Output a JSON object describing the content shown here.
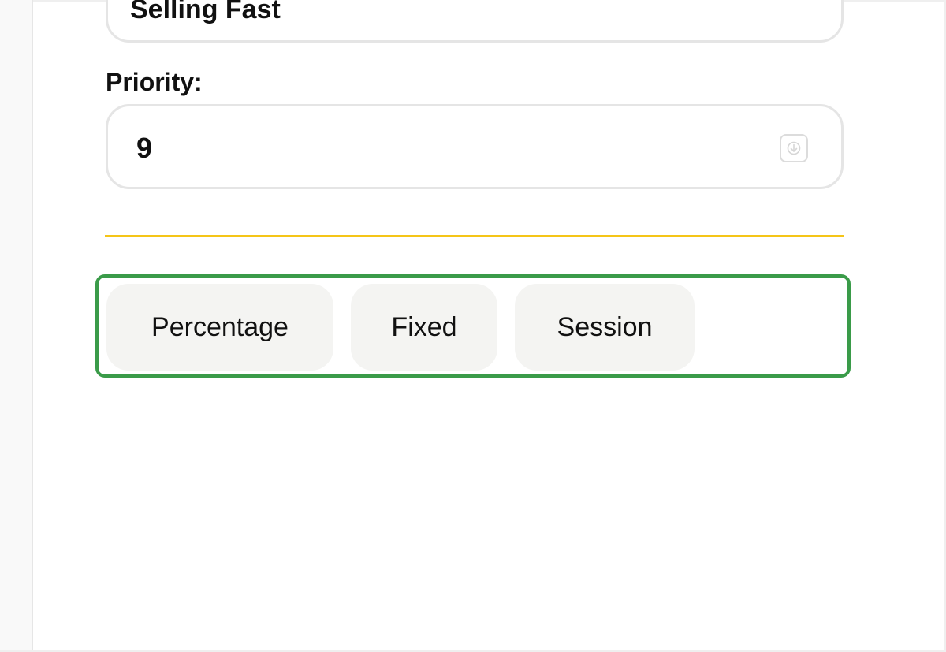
{
  "form": {
    "name_value": "Selling Fast",
    "priority_label": "Priority:",
    "priority_value": "9"
  },
  "discount_types": {
    "buttons": [
      {
        "label": "Percentage"
      },
      {
        "label": "Fixed"
      },
      {
        "label": "Session"
      }
    ]
  },
  "colors": {
    "divider": "#f5c518",
    "highlight_border": "#3a9b49",
    "button_bg": "#f4f4f2",
    "field_border": "#e5e5e5"
  },
  "icons": {
    "stepper": "arrow-down-box-icon"
  }
}
